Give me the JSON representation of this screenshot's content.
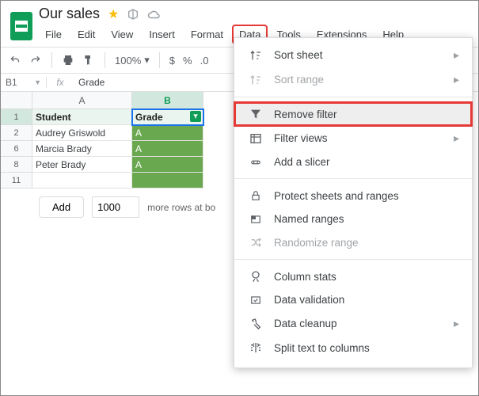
{
  "doc": {
    "title": "Our sales"
  },
  "menubar": [
    "File",
    "Edit",
    "View",
    "Insert",
    "Format",
    "Data",
    "Tools",
    "Extensions",
    "Help"
  ],
  "menubar_active_index": 5,
  "toolbar": {
    "zoom": "100%",
    "currency": "$",
    "percent": "%",
    "dec0": ".0"
  },
  "namebox": "B1",
  "formula_value": "Grade",
  "columns": [
    "A",
    "B"
  ],
  "selected_col_index": 1,
  "row_numbers": [
    "1",
    "2",
    "6",
    "8",
    "11"
  ],
  "table": {
    "headers": [
      "Student",
      "Grade"
    ],
    "rows": [
      [
        "Audrey Griswold",
        "A"
      ],
      [
        "Marcia Brady",
        "A"
      ],
      [
        "Peter Brady",
        "A"
      ]
    ]
  },
  "addrows": {
    "button": "Add",
    "count": "1000",
    "label": "more rows at bo"
  },
  "data_menu": {
    "sort_sheet": "Sort sheet",
    "sort_range": "Sort range",
    "remove_filter": "Remove filter",
    "filter_views": "Filter views",
    "add_slicer": "Add a slicer",
    "protect": "Protect sheets and ranges",
    "named_ranges": "Named ranges",
    "randomize": "Randomize range",
    "column_stats": "Column stats",
    "data_validation": "Data validation",
    "data_cleanup": "Data cleanup",
    "split_text": "Split text to columns"
  }
}
